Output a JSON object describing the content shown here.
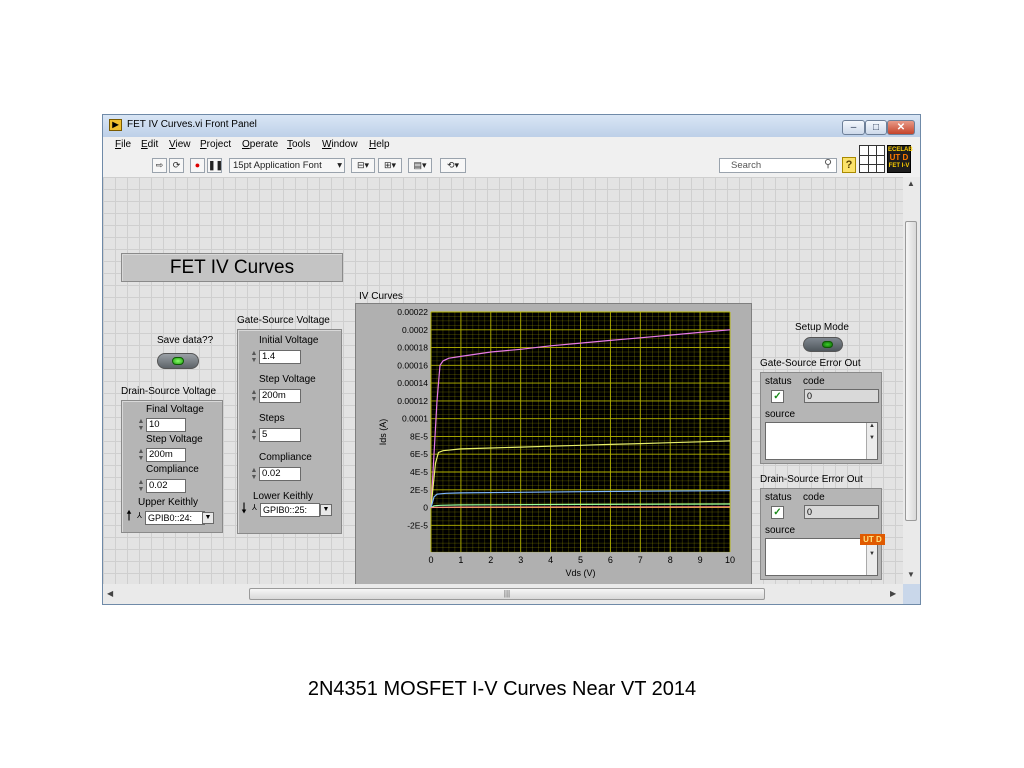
{
  "window": {
    "title": "FET IV Curves.vi Front Panel",
    "app_icon": "labview-run-icon",
    "buttons": {
      "minimize": "–",
      "maximize": "□",
      "close": "✕"
    }
  },
  "menu": [
    "File",
    "Edit",
    "View",
    "Project",
    "Operate",
    "Tools",
    "Window",
    "Help"
  ],
  "toolbar": {
    "font": "15pt Application Font",
    "search_placeholder": "Search",
    "help": "?",
    "vi_icon_text": [
      "ECELAB",
      "UT D",
      "FET I-V"
    ]
  },
  "panel": {
    "title": "FET IV Curves",
    "save": {
      "label": "Save data??"
    },
    "setup": {
      "label": "Setup Mode"
    },
    "drain_source": {
      "label": "Drain-Source Voltage",
      "final_label": "Final Voltage",
      "final_value": "10",
      "step_label": "Step Voltage",
      "step_value": "200m",
      "compliance_label": "Compliance",
      "compliance_value": "0.02",
      "keithley_label": "Upper Keithly",
      "keithley_value": "GPIB0::24:"
    },
    "gate_source": {
      "label": "Gate-Source Voltage",
      "initial_label": "Initial Voltage",
      "initial_value": "1.4",
      "step_label": "Step Voltage",
      "step_value": "200m",
      "steps_label": "Steps",
      "steps_value": "5",
      "compliance_label": "Compliance",
      "compliance_value": "0.02",
      "keithley_label": "Lower Keithly",
      "keithley_value": "GPIB0::25:"
    },
    "gs_error": {
      "label": "Gate-Source Error Out",
      "status": "status",
      "code": "code",
      "code_value": "0",
      "source": "source"
    },
    "ds_error": {
      "label": "Drain-Source Error Out",
      "status": "status",
      "code": "code",
      "code_value": "0",
      "source": "source"
    },
    "logo": "UT D"
  },
  "chart_data": {
    "type": "line",
    "title": "IV Curves",
    "xlabel": "Vds (V)",
    "ylabel": "Ids (A)",
    "xlim": [
      0,
      10
    ],
    "ylim": [
      -5e-05,
      0.00022
    ],
    "xticks": [
      "0",
      "1",
      "2",
      "3",
      "4",
      "5",
      "6",
      "7",
      "8",
      "9",
      "10"
    ],
    "yticks": [
      "0.00022",
      "0.0002",
      "0.00018",
      "0.00016",
      "0.00014",
      "0.00012",
      "0.0001",
      "8E-5",
      "6E-5",
      "4E-5",
      "2E-5",
      "0",
      "-2E-5"
    ],
    "background": "#000000",
    "grid": true,
    "grid_color": "#b5b400",
    "series": [
      {
        "color": "#e77be7",
        "x": [
          0,
          0.2,
          0.3,
          0.4,
          0.6,
          1,
          2,
          3,
          4,
          5,
          6,
          7,
          8,
          9,
          10
        ],
        "y": [
          0,
          0.00012,
          0.00016,
          0.000165,
          0.000168,
          0.00017,
          0.000175,
          0.000178,
          0.000182,
          0.000185,
          0.000188,
          0.000191,
          0.000194,
          0.000197,
          0.0002
        ]
      },
      {
        "color": "#e8f06a",
        "x": [
          0,
          0.15,
          0.25,
          0.4,
          1,
          2,
          3,
          4,
          5,
          6,
          7,
          8,
          9,
          10
        ],
        "y": [
          0,
          5e-05,
          6.2e-05,
          6.4e-05,
          6.6e-05,
          6.7e-05,
          6.8e-05,
          6.9e-05,
          7e-05,
          7.1e-05,
          7.2e-05,
          7.3e-05,
          7.4e-05,
          7.5e-05
        ]
      },
      {
        "color": "#7fb7ff",
        "x": [
          0,
          0.1,
          0.2,
          0.5,
          1,
          3,
          5,
          7,
          10
        ],
        "y": [
          0,
          1.2e-05,
          1.5e-05,
          1.6e-05,
          1.65e-05,
          1.72e-05,
          1.78e-05,
          1.84e-05,
          1.9e-05
        ]
      },
      {
        "color": "#9bffa0",
        "x": [
          0,
          0.1,
          0.3,
          1,
          5,
          10
        ],
        "y": [
          0,
          2e-06,
          2.5e-06,
          3e-06,
          3.5e-06,
          4e-06
        ]
      },
      {
        "color": "#ff8a8a",
        "x": [
          0,
          0.1,
          1,
          5,
          10
        ],
        "y": [
          0,
          3e-07,
          5e-07,
          6e-07,
          7e-07
        ]
      }
    ]
  },
  "caption": "2N4351 MOSFET I-V Curves Near VT  2014"
}
